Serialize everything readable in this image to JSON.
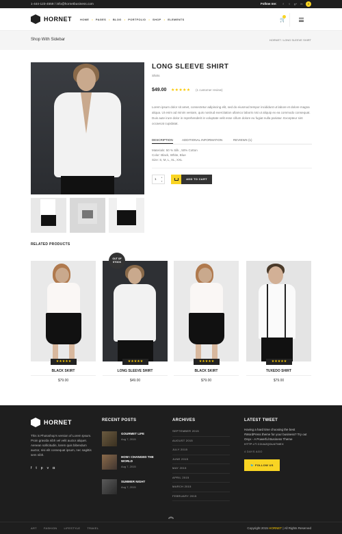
{
  "topbar": {
    "contact": "1-444-123-4559  /  info@hornetbusiness.com",
    "follow_label": "Follow me:",
    "social_icons": [
      "facebook-icon",
      "twitter-icon",
      "google-plus-icon",
      "linkedin-icon"
    ],
    "cart_count": "0"
  },
  "header": {
    "brand": "HORNET",
    "nav": [
      "HOME",
      "PAGES",
      "BLOG",
      "PORTFOLIO",
      "SHOP",
      "ELEMENTS"
    ],
    "cart_badge": "0"
  },
  "titlebar": {
    "title": "Shop With Sidebar",
    "breadcrumb": "HORNET  /  LONG SLEEVE SHIRT"
  },
  "product": {
    "title": "LONG SLEEVE SHIRT",
    "category": "Shirts",
    "price": "$49.00",
    "rating": 5,
    "reviews": "(1 customer review)",
    "description": "Lorem ipsum dolor sit amet, consectetur adipiscing elit, sed do eiusmod tempor incididunt ut labore et dolore magna aliqua. Ut enim ad minim veniam, quis nostrud exercitation ullamco laboris nisi ut aliquip ex ea commodo consequat. Duis aute irure dolor in reprehenderit in voluptate velit esse cillum dolore eu fugiat nulla pariatur. Excepteur sint occaecat cupidatat.",
    "tabs": [
      "DESCRIPTION",
      "ADDITIONAL INFORMATION",
      "REVIEWS (1)"
    ],
    "specs": [
      "Materials: 50 % Silk , 50% Cotton",
      "Color: Black, White, Blue",
      "Size: S, M, L, XL, XXL"
    ],
    "quantity": "1",
    "add_to_cart": "ADD TO CART"
  },
  "related": {
    "title": "RELATED PRODUCTS",
    "out_of_stock": "OUT OF STOCK",
    "items": [
      {
        "name": "BLACK SKIRT",
        "price": "$79.00",
        "rating": 5
      },
      {
        "name": "LONG SLEEVE SHIRT",
        "price": "$49.00",
        "rating": 5
      },
      {
        "name": "BLACK SKIRT",
        "price": "$79.00",
        "rating": 5
      },
      {
        "name": "TUXEDO SHIRT",
        "price": "$79.00",
        "rating": 5
      }
    ]
  },
  "footer": {
    "brand": "HORNET",
    "about": "This is Photoshop's version of Lorem Ipsum. Proin gravida nibh vel velit auctor aliquet. Aenean sollicitudin, lorem quis bibendum auctor, nisi elit consequat ipsum, nec sagittis sem nibh.",
    "social_icons": [
      "facebook-icon",
      "twitter-icon",
      "pinterest-icon",
      "vimeo-icon",
      "flickr-icon"
    ],
    "recent_posts_title": "RECENT POSTS",
    "posts": [
      {
        "title": "GOURMET LIFE",
        "date": "Aug 7, 2015"
      },
      {
        "title": "HOW I CHANGED THE WORLD",
        "date": "Aug 7, 2015"
      },
      {
        "title": "SUMMER NIGHT",
        "date": "Aug 7, 2015"
      }
    ],
    "archives_title": "ARCHIVES",
    "archives": [
      "SEPTEMBER 2015",
      "AUGUST 2015",
      "JULY 2015",
      "JUNE 2015",
      "MAY 2015",
      "APRIL 2015",
      "MARCH 2015",
      "FEBRUARY 2015"
    ],
    "tweet_title": "LATEST TWEET",
    "tweet": "Having a hard time choosing the best #WordPress theme for your business? Try out Onyx - A Powerful Business Theme",
    "tweet_link": "HTTP://T.CO/AZQDU4TMEX",
    "tweet_ago": "4 DAYS AGO",
    "follow_us": "FOLLOW US",
    "bottom_links": [
      "ART",
      "FASHION",
      "LIFESTYLE",
      "TRAVEL"
    ],
    "copyright_pre": "Copyright 2015",
    "copyright_brand": "HORNET",
    "copyright_post": "| All Rights Reserved"
  },
  "colors": {
    "accent": "#f9d423",
    "dark": "#1e1e1e"
  }
}
